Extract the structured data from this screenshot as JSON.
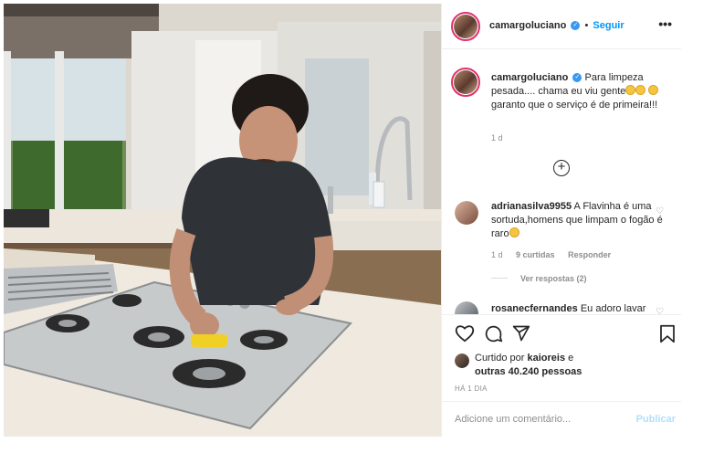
{
  "header": {
    "username": "camargoluciano",
    "separator": "•",
    "follow_label": "Seguir",
    "more_icon": "more-dots-icon"
  },
  "caption": {
    "username": "camargoluciano",
    "text_1": "Para limpeza pesada.... chama eu viu gente",
    "text_2": "garanto que o serviço é de primeira!!!",
    "time": "1 d"
  },
  "load_more_icon": "plus-circle-icon",
  "comments": [
    {
      "username": "adrianasilva9955",
      "text": "A Flavinha é uma sortuda,homens que limpam o fogão é raro",
      "time": "1 d",
      "likes": "9 curtidas",
      "reply": "Responder",
      "view_replies": "Ver respostas (2)"
    },
    {
      "username": "rosanecfernandes",
      "text": "Eu adoro lavar"
    }
  ],
  "actions": {
    "liked_by_prefix": "Curtido por",
    "liked_by_user": "kaioreis",
    "liked_by_and": "e",
    "others": "outras 40.240 pessoas",
    "ago": "HÁ 1 DIA"
  },
  "add_comment": {
    "placeholder": "Adicione um comentário...",
    "publish": "Publicar"
  },
  "colors": {
    "link_blue": "#0095f6",
    "verified_blue": "#3897f0",
    "muted": "#8e8e8e",
    "publish_disabled": "#b2dffc"
  }
}
